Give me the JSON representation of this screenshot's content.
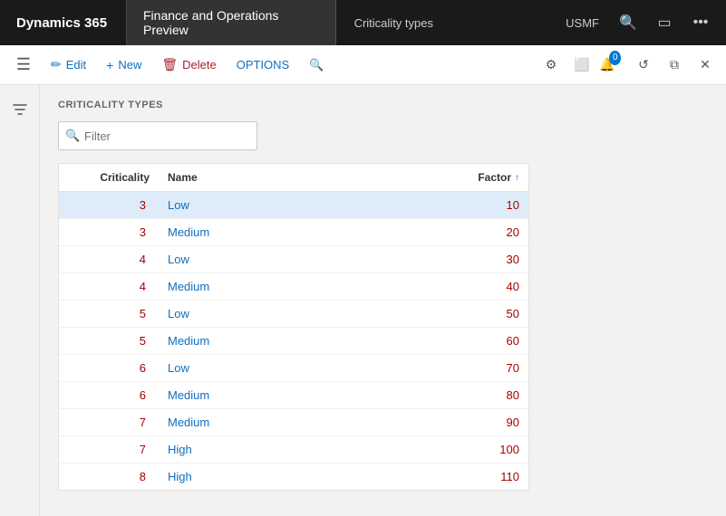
{
  "topNav": {
    "d365Label": "Dynamics 365",
    "appLabel": "Finance and Operations Preview",
    "pageLabel": "Criticality types",
    "company": "USMF",
    "searchIcon": "🔍",
    "bookmarkIcon": "🔲",
    "moreIcon": "•••",
    "notifCount": "0"
  },
  "toolbar": {
    "hamburgerIcon": "≡",
    "editLabel": "Edit",
    "newLabel": "New",
    "deleteLabel": "Delete",
    "optionsLabel": "OPTIONS",
    "searchIcon": "🔍",
    "settingsIcon": "⚙",
    "officeIcon": "⬜",
    "refreshIcon": "↺",
    "openIcon": "⧉",
    "closeIcon": "✕"
  },
  "content": {
    "sectionTitle": "CRITICALITY TYPES",
    "filterPlaceholder": "Filter",
    "table": {
      "headers": [
        {
          "label": "Criticality",
          "align": "right"
        },
        {
          "label": "Name",
          "align": "left"
        },
        {
          "label": "Factor",
          "align": "right",
          "sorted": true,
          "sortDir": "asc"
        }
      ],
      "rows": [
        {
          "criticality": "3",
          "name": "Low",
          "factor": "10",
          "selected": true
        },
        {
          "criticality": "3",
          "name": "Medium",
          "factor": "20",
          "selected": false
        },
        {
          "criticality": "4",
          "name": "Low",
          "factor": "30",
          "selected": false
        },
        {
          "criticality": "4",
          "name": "Medium",
          "factor": "40",
          "selected": false
        },
        {
          "criticality": "5",
          "name": "Low",
          "factor": "50",
          "selected": false
        },
        {
          "criticality": "5",
          "name": "Medium",
          "factor": "60",
          "selected": false
        },
        {
          "criticality": "6",
          "name": "Low",
          "factor": "70",
          "selected": false
        },
        {
          "criticality": "6",
          "name": "Medium",
          "factor": "80",
          "selected": false
        },
        {
          "criticality": "7",
          "name": "Medium",
          "factor": "90",
          "selected": false
        },
        {
          "criticality": "7",
          "name": "High",
          "factor": "100",
          "selected": false
        },
        {
          "criticality": "8",
          "name": "High",
          "factor": "110",
          "selected": false
        }
      ]
    }
  }
}
